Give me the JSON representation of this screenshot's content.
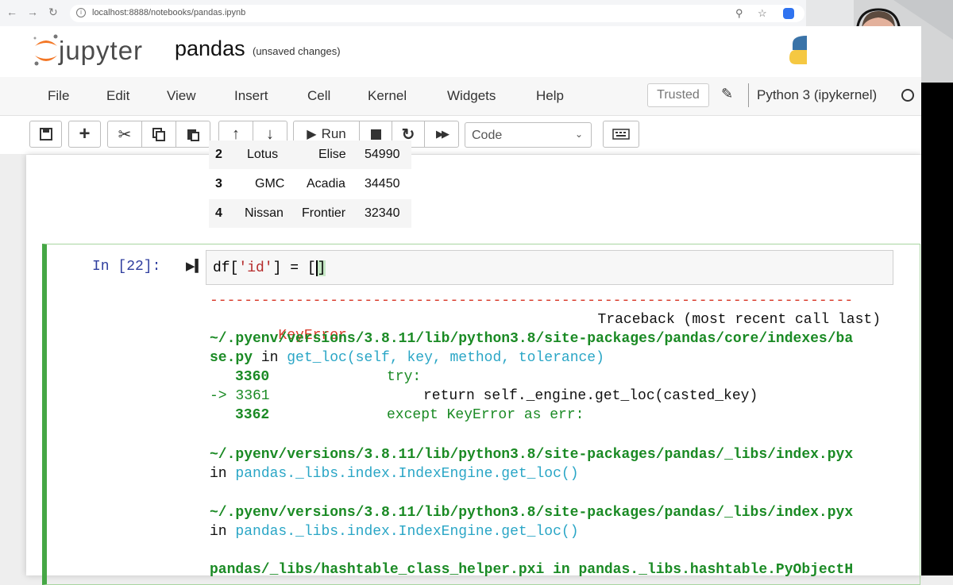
{
  "browser": {
    "url": "localhost:8888/notebooks/pandas.ipynb"
  },
  "header": {
    "brand": "jupyter",
    "notebook_name": "pandas",
    "save_status": "(unsaved changes)"
  },
  "menu": {
    "items": [
      "File",
      "Edit",
      "View",
      "Insert",
      "Cell",
      "Kernel",
      "Widgets",
      "Help"
    ],
    "trusted": "Trusted",
    "kernel": "Python 3 (ipykernel)"
  },
  "toolbar": {
    "run_label": "Run",
    "cell_type": "Code"
  },
  "dataframe": {
    "rows": [
      {
        "index": "2",
        "make": "Lotus",
        "model": "Elise",
        "price": "54990"
      },
      {
        "index": "3",
        "make": "GMC",
        "model": "Acadia",
        "price": "34450"
      },
      {
        "index": "4",
        "make": "Nissan",
        "model": "Frontier",
        "price": "32340"
      }
    ]
  },
  "cell": {
    "prompt": "In [22]:",
    "code_var": "df[",
    "code_key": "'id'",
    "code_rest": "] = [",
    "code_cursor": "]"
  },
  "output": {
    "separator": "---------------------------------------------------------------------------",
    "error_name": "KeyError",
    "traceback_label": "Traceback (most recent call last)",
    "path1a": "~/.pyenv/versions/3.8.11/lib/python3.8/site-packages/pandas/core/indexes/ba",
    "path1b": "se.py",
    "path1_in": " in ",
    "func1": "get_loc(self, key, method, tolerance)",
    "l3360_no": "3360",
    "l3360_code": "try:",
    "l3361_arrow": "-> 3361",
    "l3361_code": "return self._engine.get_loc(casted_key)",
    "l3362_no": "3362",
    "l3362_code": "except KeyError as err:",
    "path2": "~/.pyenv/versions/3.8.11/lib/python3.8/site-packages/pandas/_libs/index.pyx",
    "in_word": "in",
    "func2": "pandas._libs.index.IndexEngine.get_loc()",
    "path3": "~/.pyenv/versions/3.8.11/lib/python3.8/site-packages/pandas/_libs/index.pyx",
    "func3": "pandas._libs.index.IndexEngine.get_loc()",
    "path4": "pandas/_libs/hashtable_class_helper.pxi in pandas._libs.hashtable.PyObjectH"
  }
}
